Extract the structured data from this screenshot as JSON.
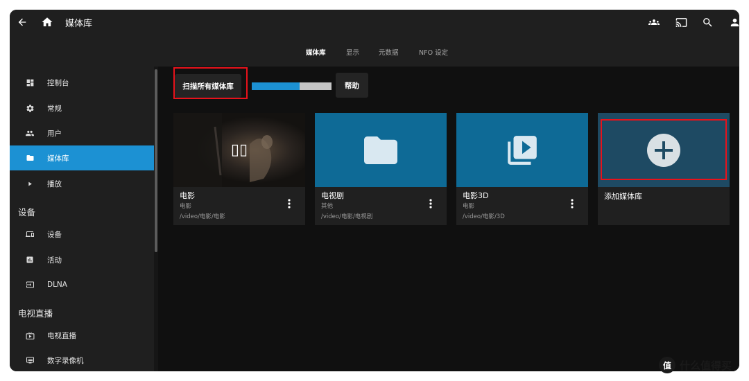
{
  "header": {
    "title": "媒体库",
    "tabs": [
      {
        "label": "媒体库",
        "active": true
      },
      {
        "label": "显示",
        "active": false
      },
      {
        "label": "元数据",
        "active": false
      },
      {
        "label": "NFO 设定",
        "active": false
      }
    ],
    "icons": [
      "back-icon",
      "home-icon",
      "users-icon",
      "cast-icon",
      "search-icon",
      "account-icon"
    ]
  },
  "sidebar": {
    "items": [
      {
        "label": "控制台",
        "icon": "dashboard-icon"
      },
      {
        "label": "常规",
        "icon": "gear-icon"
      },
      {
        "label": "用户",
        "icon": "users-icon"
      },
      {
        "label": "媒体库",
        "icon": "folder-icon",
        "active": true
      },
      {
        "label": "播放",
        "icon": "play-icon"
      }
    ],
    "sections": [
      {
        "title": "设备",
        "items": [
          {
            "label": "设备",
            "icon": "devices-icon"
          },
          {
            "label": "活动",
            "icon": "activity-icon"
          },
          {
            "label": "DLNA",
            "icon": "input-icon"
          }
        ]
      },
      {
        "title": "电视直播",
        "items": [
          {
            "label": "电视直播",
            "icon": "live-tv-icon"
          },
          {
            "label": "数字录像机",
            "icon": "dvr-icon"
          }
        ]
      }
    ]
  },
  "toolbar": {
    "scan_label": "扫描所有媒体库",
    "help_label": "帮助",
    "scan_progress": 0.6
  },
  "libraries": [
    {
      "title": "电影",
      "type": "电影",
      "path": "/video/电影/电影",
      "icon": "movie-thumbnail",
      "glyph": "▯▯"
    },
    {
      "title": "电视剧",
      "type": "其他",
      "path": "/video/电影/电视剧",
      "icon": "folder-icon"
    },
    {
      "title": "电影3D",
      "type": "电影",
      "path": "/video/电影/3D",
      "icon": "video-library-icon"
    }
  ],
  "add_library": {
    "label": "添加媒体库",
    "icon": "add-circle-icon"
  },
  "colors": {
    "accent": "#1c91d3",
    "highlight": "#e8121b",
    "card_blue": "#0e6a96",
    "add_card_bg": "#1e4a63"
  },
  "watermark": {
    "text": "什么值得买",
    "logo_glyph": "值"
  }
}
